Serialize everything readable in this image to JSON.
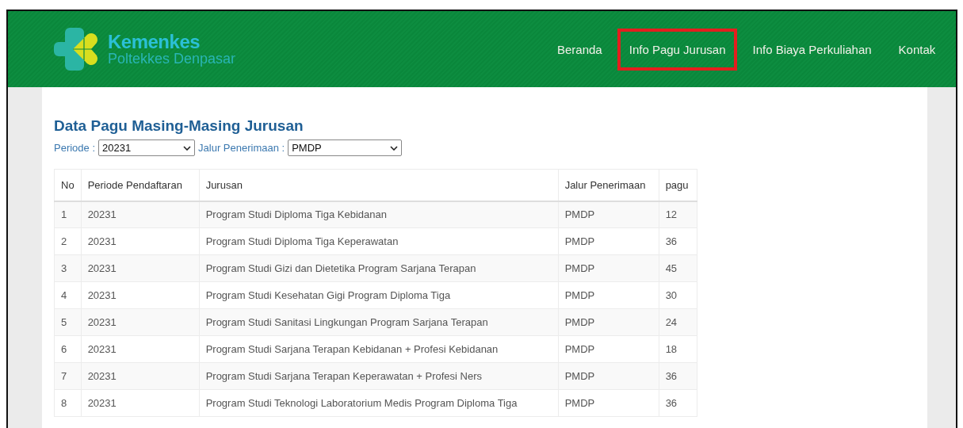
{
  "brand": {
    "title": "Kemenkes",
    "subtitle": "Poltekkes Denpasar"
  },
  "nav": [
    {
      "label": "Beranda",
      "selected": false
    },
    {
      "label": "Info Pagu Jurusan",
      "selected": true
    },
    {
      "label": "Info Biaya Perkuliahan",
      "selected": false
    },
    {
      "label": "Kontak",
      "selected": false
    }
  ],
  "heading": "Data Pagu Masing-Masing Jurusan",
  "filters": [
    {
      "label": "Periode :",
      "value": "20231"
    },
    {
      "label": "Jalur Penerimaan :",
      "value": "PMDP"
    }
  ],
  "table": {
    "columns": [
      "No",
      "Periode Pendaftaran",
      "Jurusan",
      "Jalur Penerimaan",
      "pagu"
    ],
    "rows": [
      [
        "1",
        "20231",
        "Program Studi Diploma Tiga Kebidanan",
        "PMDP",
        "12"
      ],
      [
        "2",
        "20231",
        "Program Studi Diploma Tiga Keperawatan",
        "PMDP",
        "36"
      ],
      [
        "3",
        "20231",
        "Program Studi Gizi dan Dietetika Program Sarjana Terapan",
        "PMDP",
        "45"
      ],
      [
        "4",
        "20231",
        "Program Studi Kesehatan Gigi Program Diploma Tiga",
        "PMDP",
        "30"
      ],
      [
        "5",
        "20231",
        "Program Studi Sanitasi Lingkungan Program Sarjana Terapan",
        "PMDP",
        "24"
      ],
      [
        "6",
        "20231",
        "Program Studi Sarjana Terapan Kebidanan + Profesi Kebidanan",
        "PMDP",
        "18"
      ],
      [
        "7",
        "20231",
        "Program Studi Sarjana Terapan Keperawatan + Profesi Ners",
        "PMDP",
        "36"
      ],
      [
        "8",
        "20231",
        "Program Studi Teknologi Laboratorium Medis Program Diploma Tiga",
        "PMDP",
        "36"
      ]
    ]
  }
}
